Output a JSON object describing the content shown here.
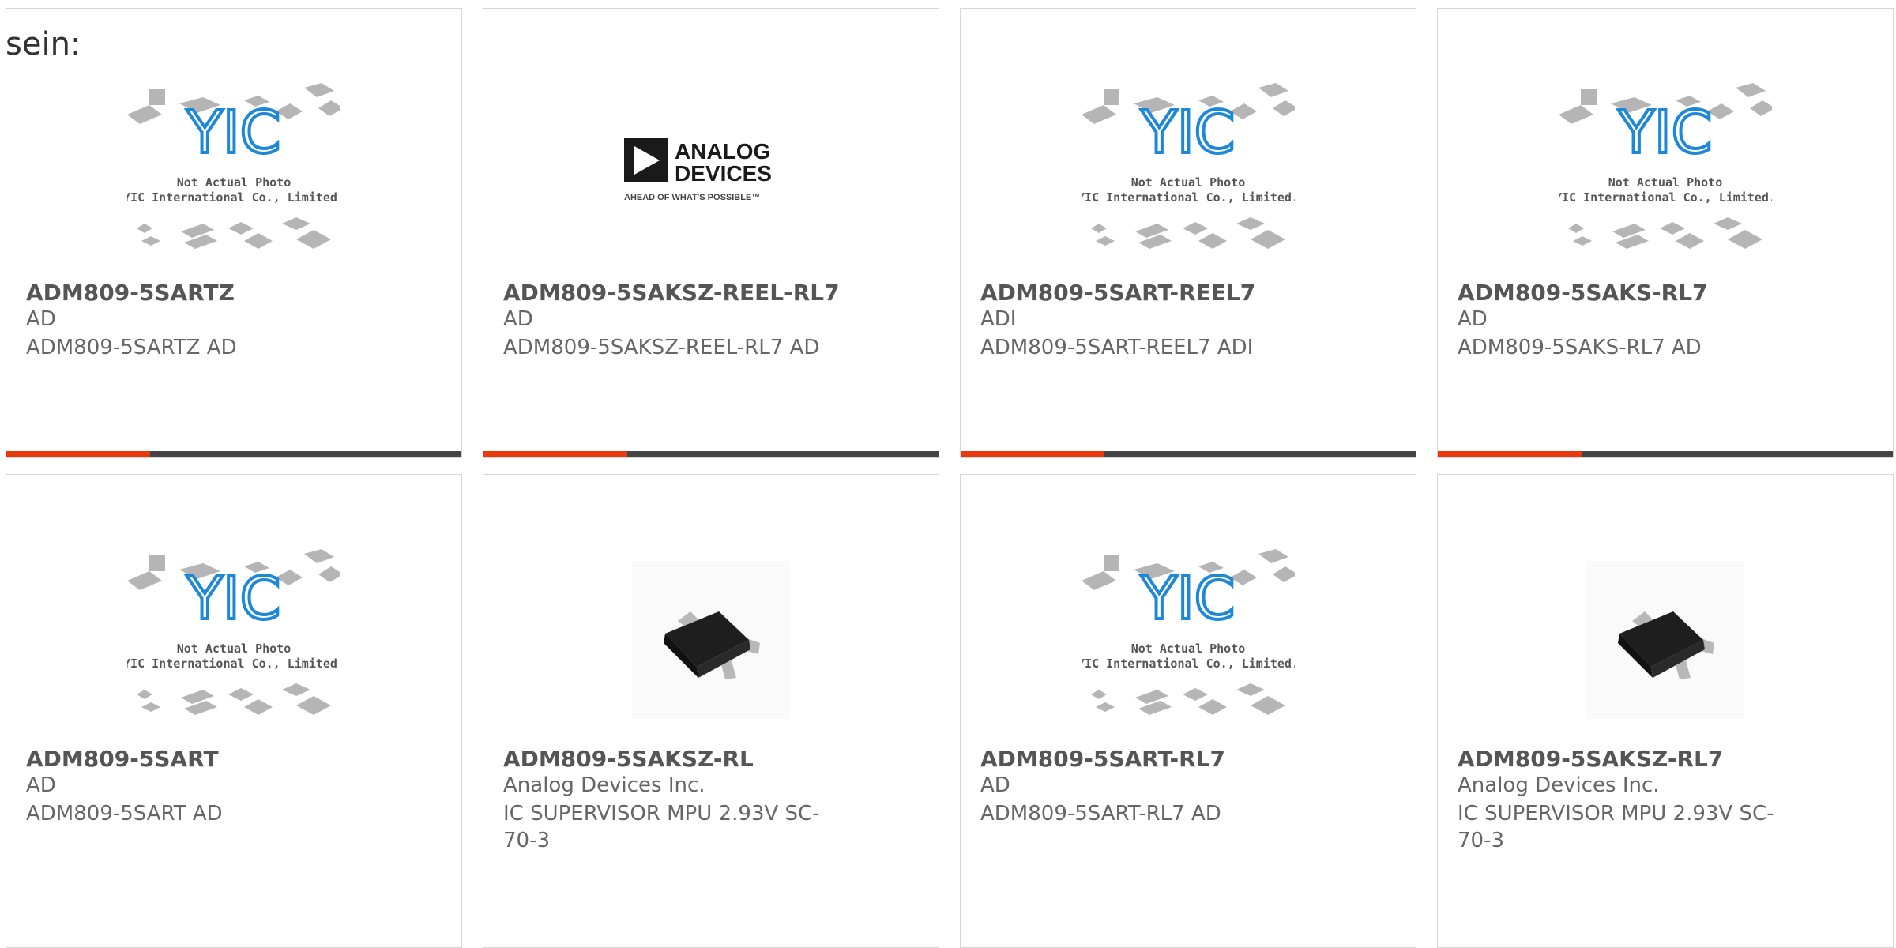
{
  "intro": "sein:",
  "placeholder_text": {
    "line1": "Not Actual Photo",
    "line2": "YIC International Co., Limited.",
    "logo": "YIC"
  },
  "adi_logo": {
    "line1": "ANALOG",
    "line2": "DEVICES",
    "tagline": "AHEAD OF WHAT'S POSSIBLE™"
  },
  "products": [
    {
      "name": "ADM809-5SARTZ",
      "maker": "AD",
      "desc": "ADM809-5SARTZ AD",
      "image": "yic-placeholder"
    },
    {
      "name": "ADM809-5SAKSZ-REEL-RL7",
      "maker": "AD",
      "desc": "ADM809-5SAKSZ-REEL-RL7 AD",
      "image": "analog-devices-logo"
    },
    {
      "name": "ADM809-5SART-REEL7",
      "maker": "ADI",
      "desc": "ADM809-5SART-REEL7 ADI",
      "image": "yic-placeholder"
    },
    {
      "name": "ADM809-5SAKS-RL7",
      "maker": "AD",
      "desc": "ADM809-5SAKS-RL7 AD",
      "image": "yic-placeholder"
    },
    {
      "name": "ADM809-5SART",
      "maker": "AD",
      "desc": "ADM809-5SART AD",
      "image": "yic-placeholder"
    },
    {
      "name": "ADM809-5SAKSZ-RL",
      "maker": "Analog Devices Inc.",
      "desc": "IC SUPERVISOR MPU 2.93V SC-70-3",
      "image": "sc70-chip-photo"
    },
    {
      "name": "ADM809-5SART-RL7",
      "maker": "AD",
      "desc": "ADM809-5SART-RL7 AD",
      "image": "yic-placeholder"
    },
    {
      "name": "ADM809-5SAKSZ-RL7",
      "maker": "Analog Devices Inc.",
      "desc": "IC SUPERVISOR MPU 2.93V SC-70-3",
      "image": "sc70-chip-photo"
    }
  ],
  "colors": {
    "accent": "#e8380d",
    "bar": "#444444",
    "yic_blue": "#1e88d8"
  }
}
